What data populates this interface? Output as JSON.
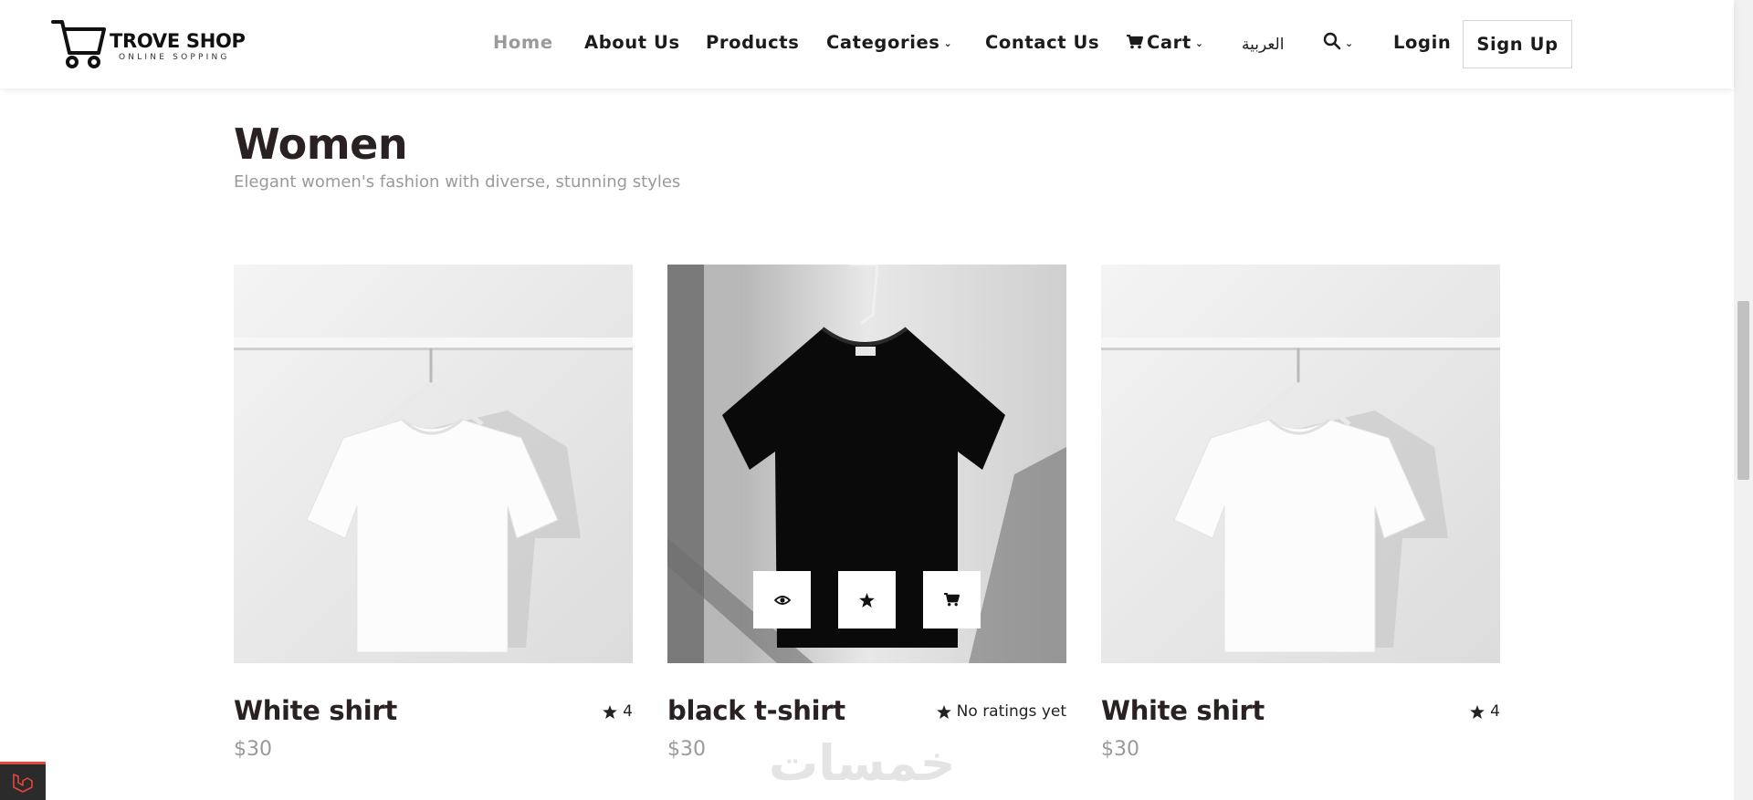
{
  "brand": {
    "name": "TROVE SHOP",
    "tagline": "ONLINE SOPPING"
  },
  "nav": {
    "home": "Home",
    "about": "About Us",
    "products": "Products",
    "categories": "Categories",
    "contact": "Contact Us",
    "cart": "Cart",
    "language": "العربية",
    "login": "Login",
    "signup": "Sign Up"
  },
  "section": {
    "title": "Women",
    "subtitle": "Elegant women's fashion with diverse, stunning styles"
  },
  "products": [
    {
      "name": "White shirt",
      "price": "$30",
      "rating": "4",
      "color": "#ffffff"
    },
    {
      "name": "black t-shirt",
      "price": "$30",
      "rating": "No ratings yet",
      "color": "#0a0a0a"
    },
    {
      "name": "White shirt",
      "price": "$30",
      "rating": "4",
      "color": "#ffffff"
    }
  ],
  "card_actions": [
    "eye-icon",
    "star-icon",
    "cart-icon"
  ],
  "watermark": "خمسات",
  "colors": {
    "active_nav": "#9a9a9a",
    "text_dark": "#2a2222",
    "muted": "#9a9a9a",
    "debug_accent": "#e4473b"
  }
}
